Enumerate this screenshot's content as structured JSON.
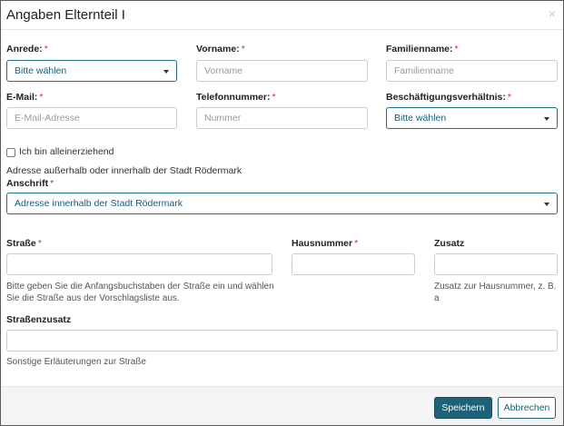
{
  "dialog": {
    "title": "Angaben Elternteil I",
    "close_symbol": "×"
  },
  "form": {
    "anrede": {
      "label": "Anrede:",
      "required": "*",
      "value": "Bitte wählen"
    },
    "vorname": {
      "label": "Vorname:",
      "required": "*",
      "placeholder": "Vorname"
    },
    "familienname": {
      "label": "Familienname:",
      "required": "*",
      "placeholder": "Familienname"
    },
    "email": {
      "label": "E-Mail:",
      "required": "*",
      "placeholder": "E-Mail-Adresse"
    },
    "telefon": {
      "label": "Telefonnummer:",
      "required": "*",
      "placeholder": "Nummer"
    },
    "beschaeftigung": {
      "label": "Beschäftigungsverhältnis:",
      "required": "*",
      "value": "Bitte wählen"
    },
    "alleinerziehend": {
      "label": "Ich bin alleinerziehend"
    },
    "adresse_hint": "Adresse außerhalb oder innerhalb der Stadt Rödermark",
    "anschrift": {
      "label": "Anschrift",
      "required": "*",
      "value": "Adresse innerhalb der Stadt Rödermark"
    },
    "strasse": {
      "label": "Straße",
      "required": "*",
      "value": "",
      "help": "Bitte geben Sie die Anfangsbuchstaben der Straße ein und wählen Sie die Straße aus der Vorschlagsliste aus."
    },
    "hausnummer": {
      "label": "Hausnummer",
      "required": "*",
      "value": ""
    },
    "zusatz": {
      "label": "Zusatz",
      "value": "",
      "help": "Zusatz zur Hausnummer, z. B. a"
    },
    "strassenzusatz": {
      "label": "Straßenzusatz",
      "value": "",
      "help": "Sonstige Erläuterungen zur Straße"
    }
  },
  "footer": {
    "save_label": "Speichern",
    "cancel_label": "Abbrechen"
  },
  "colors": {
    "primary": "#1d6278",
    "required": "#c9302c",
    "select_text": "#1a5d78"
  }
}
